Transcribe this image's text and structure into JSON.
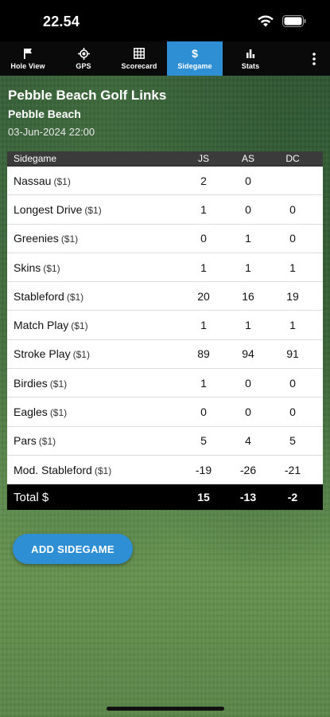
{
  "status_bar": {
    "time": "22.54",
    "icons": [
      "wifi-icon",
      "battery-icon"
    ]
  },
  "tabs": [
    {
      "label": "Hole View",
      "icon": "flag-icon",
      "active": false
    },
    {
      "label": "GPS",
      "icon": "crosshair-icon",
      "active": false
    },
    {
      "label": "Scorecard",
      "icon": "grid-icon",
      "active": false
    },
    {
      "label": "Sidegame",
      "icon": "dollar-icon",
      "active": true
    },
    {
      "label": "Stats",
      "icon": "bar-chart-icon",
      "active": false
    }
  ],
  "more_icon": "more-vertical-icon",
  "course": {
    "name": "Pebble Beach Golf Links",
    "subtitle": "Pebble Beach",
    "date": "03-Jun-2024 22:00"
  },
  "table": {
    "header": {
      "name": "Sidegame",
      "players": [
        "JS",
        "AS",
        "DC"
      ]
    },
    "rows": [
      {
        "name": "Nassau",
        "stake": "($1)",
        "values": [
          "2",
          "0",
          ""
        ]
      },
      {
        "name": "Longest Drive",
        "stake": "($1)",
        "values": [
          "1",
          "0",
          "0"
        ]
      },
      {
        "name": "Greenies",
        "stake": "($1)",
        "values": [
          "0",
          "1",
          "0"
        ]
      },
      {
        "name": "Skins",
        "stake": "($1)",
        "values": [
          "1",
          "1",
          "1"
        ]
      },
      {
        "name": "Stableford",
        "stake": "($1)",
        "values": [
          "20",
          "16",
          "19"
        ]
      },
      {
        "name": "Match Play",
        "stake": "($1)",
        "values": [
          "1",
          "1",
          "1"
        ]
      },
      {
        "name": "Stroke Play",
        "stake": "($1)",
        "values": [
          "89",
          "94",
          "91"
        ]
      },
      {
        "name": "Birdies",
        "stake": "($1)",
        "values": [
          "1",
          "0",
          "0"
        ]
      },
      {
        "name": "Eagles",
        "stake": "($1)",
        "values": [
          "0",
          "0",
          "0"
        ]
      },
      {
        "name": "Pars",
        "stake": "($1)",
        "values": [
          "5",
          "4",
          "5"
        ]
      },
      {
        "name": "Mod. Stableford",
        "stake": "($1)",
        "values": [
          "-19",
          "-26",
          "-21"
        ]
      }
    ],
    "total": {
      "name": "Total $",
      "values": [
        "15",
        "-13",
        "-2"
      ]
    }
  },
  "add_button_label": "ADD SIDEGAME",
  "colors": {
    "accent": "#2f8fd5",
    "header_bg": "#3b3b3b",
    "total_bg": "#000000"
  }
}
